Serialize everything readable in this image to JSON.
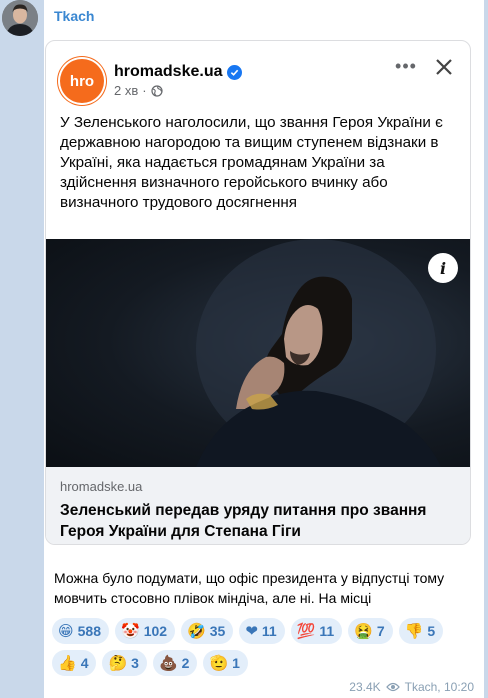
{
  "chat": {
    "sender_name": "Tkach"
  },
  "fb_post": {
    "page_name": "hromadske.ua",
    "logo_text": "hro",
    "time": "2 хв",
    "meta_separator": "·",
    "post_text": "У Зеленського наголосили, що звання Героя України є державною нагородою та вищим ступенем відзнаки в Україні, яка надається громадянам України за здійснення визначного геройського вчинку або визначного трудового досягнення",
    "info_label": "i",
    "link_domain": "hromadske.ua",
    "link_title": "Зеленський передав уряду питання про звання Героя України для Степана Гіги"
  },
  "message": {
    "caption": "Можна було подумати, що офіс президента у відпустці тому мовчить стосовно плівок міндіча, але ні. На місці"
  },
  "reactions": [
    {
      "emoji": "😁",
      "count": "588"
    },
    {
      "emoji": "🤡",
      "count": "102"
    },
    {
      "emoji": "🤣",
      "count": "35"
    },
    {
      "emoji": "❤",
      "count": "11"
    },
    {
      "emoji": "💯",
      "count": "11"
    },
    {
      "emoji": "🤮",
      "count": "7"
    },
    {
      "emoji": "👎",
      "count": "5"
    },
    {
      "emoji": "👍",
      "count": "4"
    },
    {
      "emoji": "🤔",
      "count": "3"
    },
    {
      "emoji": "💩",
      "count": "2"
    },
    {
      "emoji": "🫡",
      "count": "1"
    }
  ],
  "footer": {
    "views": "23.4K",
    "author_time": "Tkach, 10:20"
  },
  "colors": {
    "chat_background": "#c9d8ea",
    "sender_name": "#3a87d1",
    "hromadske_orange": "#f56b1c",
    "verified_blue": "#1877f2",
    "reaction_bg": "#e3eefa"
  }
}
